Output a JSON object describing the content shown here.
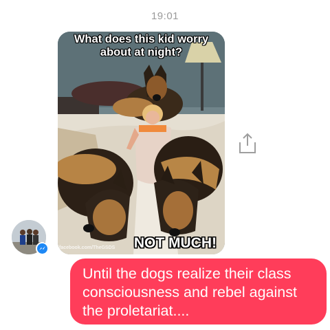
{
  "conversation": {
    "timestamp": "19:01",
    "image_message": {
      "meme_top_text": "What does this kid worry about at night?",
      "meme_bottom_text": "NOT MUCH!",
      "watermark": "facebook.com/TheGSDS"
    },
    "share_icon": "share-icon",
    "sender_avatar_badge": "messenger-icon",
    "outgoing_message": {
      "text": "Until the dogs realize their class consciousness and rebel against the proletariat....",
      "color": "#ff3d5a"
    }
  }
}
